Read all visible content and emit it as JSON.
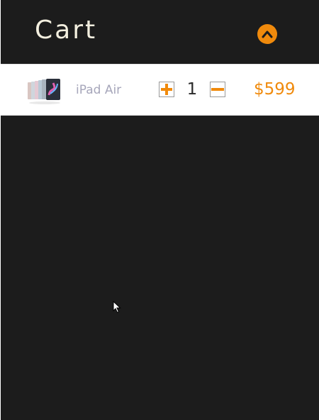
{
  "cart": {
    "title": "Cart",
    "collapse_icon": "chevron-up-icon",
    "accent_color": "#f08a0c",
    "items": [
      {
        "name": "iPad Air",
        "quantity": "1",
        "price": "$599",
        "thumbnail_icon": "ipad-thumbnail",
        "increase_icon": "plus-icon",
        "decrease_icon": "minus-icon"
      }
    ]
  }
}
